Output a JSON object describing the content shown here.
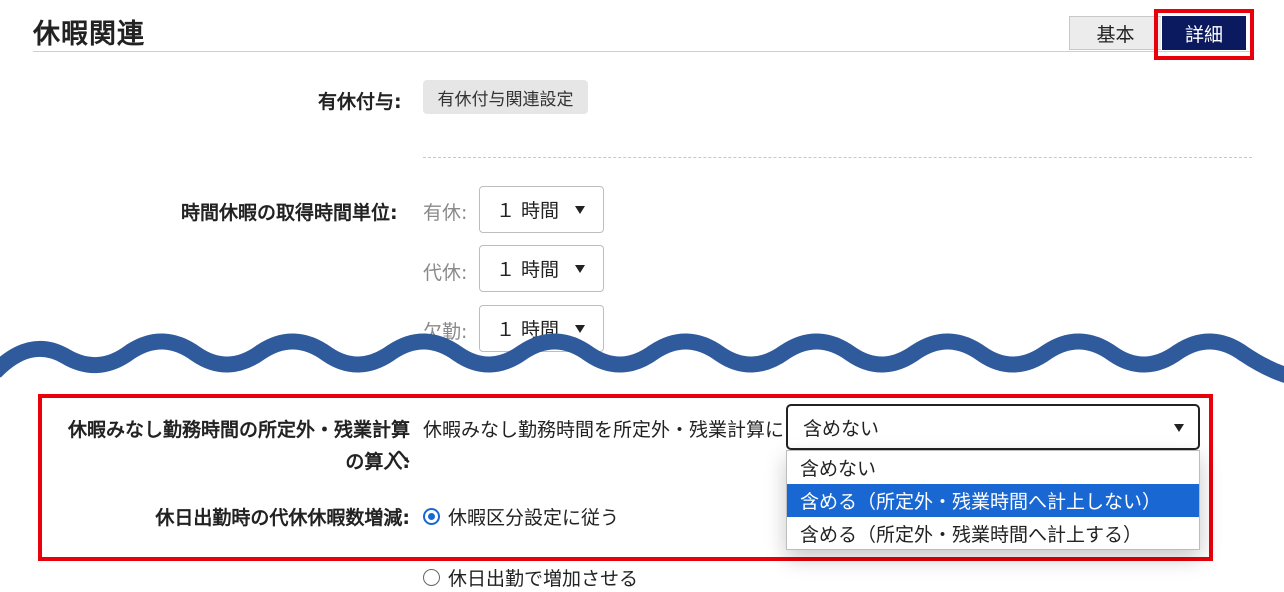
{
  "page": {
    "title": "休暇関連"
  },
  "tabs": {
    "basic": "基本",
    "detail": "詳細"
  },
  "paid_leave": {
    "label": "有休付与:",
    "button": "有休付与関連設定"
  },
  "hourly_unit": {
    "label": "時間休暇の取得時間単位:",
    "rows": [
      {
        "label": "有休:",
        "value": "１ 時間"
      },
      {
        "label": "代休:",
        "value": "１ 時間"
      },
      {
        "label": "欠勤:",
        "value": "１ 時間"
      }
    ]
  },
  "deemed_hours": {
    "label_line1": "休暇みなし勤務時間の所定外・残業計算へ",
    "label_line2": "の算入:",
    "inline_text": "休暇みなし勤務時間を所定外・残業計算に",
    "select_value": "含めない",
    "options": [
      "含めない",
      "含める（所定外・残業時間へ計上しない）",
      "含める（所定外・残業時間へ計上する）"
    ],
    "highlighted_index": 1
  },
  "holiday_work": {
    "label": "休日出勤時の代休休暇数増減:",
    "options": [
      "休暇区分設定に従う",
      "休日出勤で増加させる"
    ],
    "checked_index": 0
  },
  "colors": {
    "highlight_red": "#e8000b",
    "tab_active": "#0b1a5e",
    "wave": "#2f5a9c",
    "option_selected": "#1967d2"
  }
}
